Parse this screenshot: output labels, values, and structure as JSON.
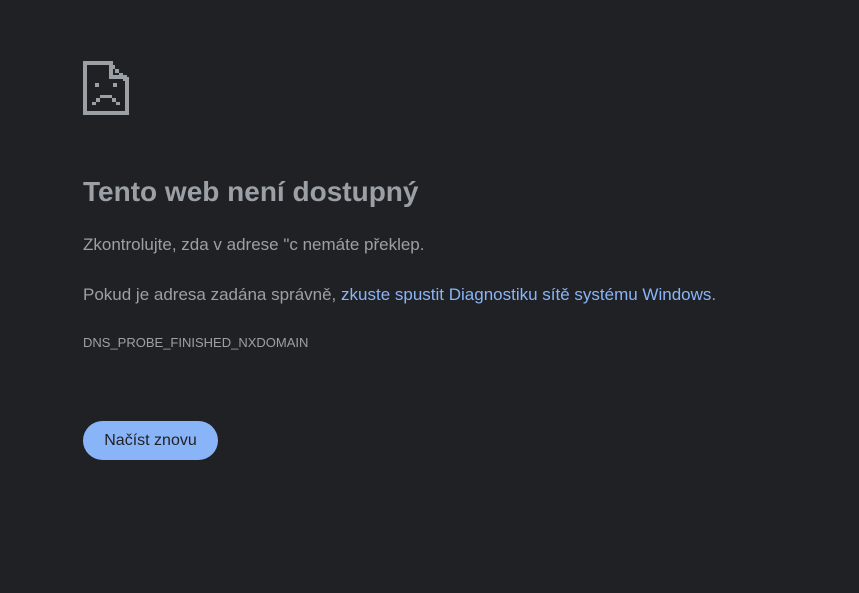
{
  "error_page": {
    "icon": "sad-document-icon",
    "title": "Tento web není dostupný",
    "paragraph1": "Zkontrolujte, zda v adrese \"c nemáte překlep.",
    "paragraph2_prefix": "Pokud je adresa zadána správně, ",
    "paragraph2_link": "zkuste spustit Diagnostiku sítě systému Windows",
    "paragraph2_suffix": ".",
    "error_code": "DNS_PROBE_FINISHED_NXDOMAIN",
    "reload_button": "Načíst znovu"
  },
  "colors": {
    "background": "#202124",
    "text": "#9aa0a6",
    "link": "#8ab4f8",
    "button_bg": "#8ab4f8",
    "button_text": "#202124"
  }
}
